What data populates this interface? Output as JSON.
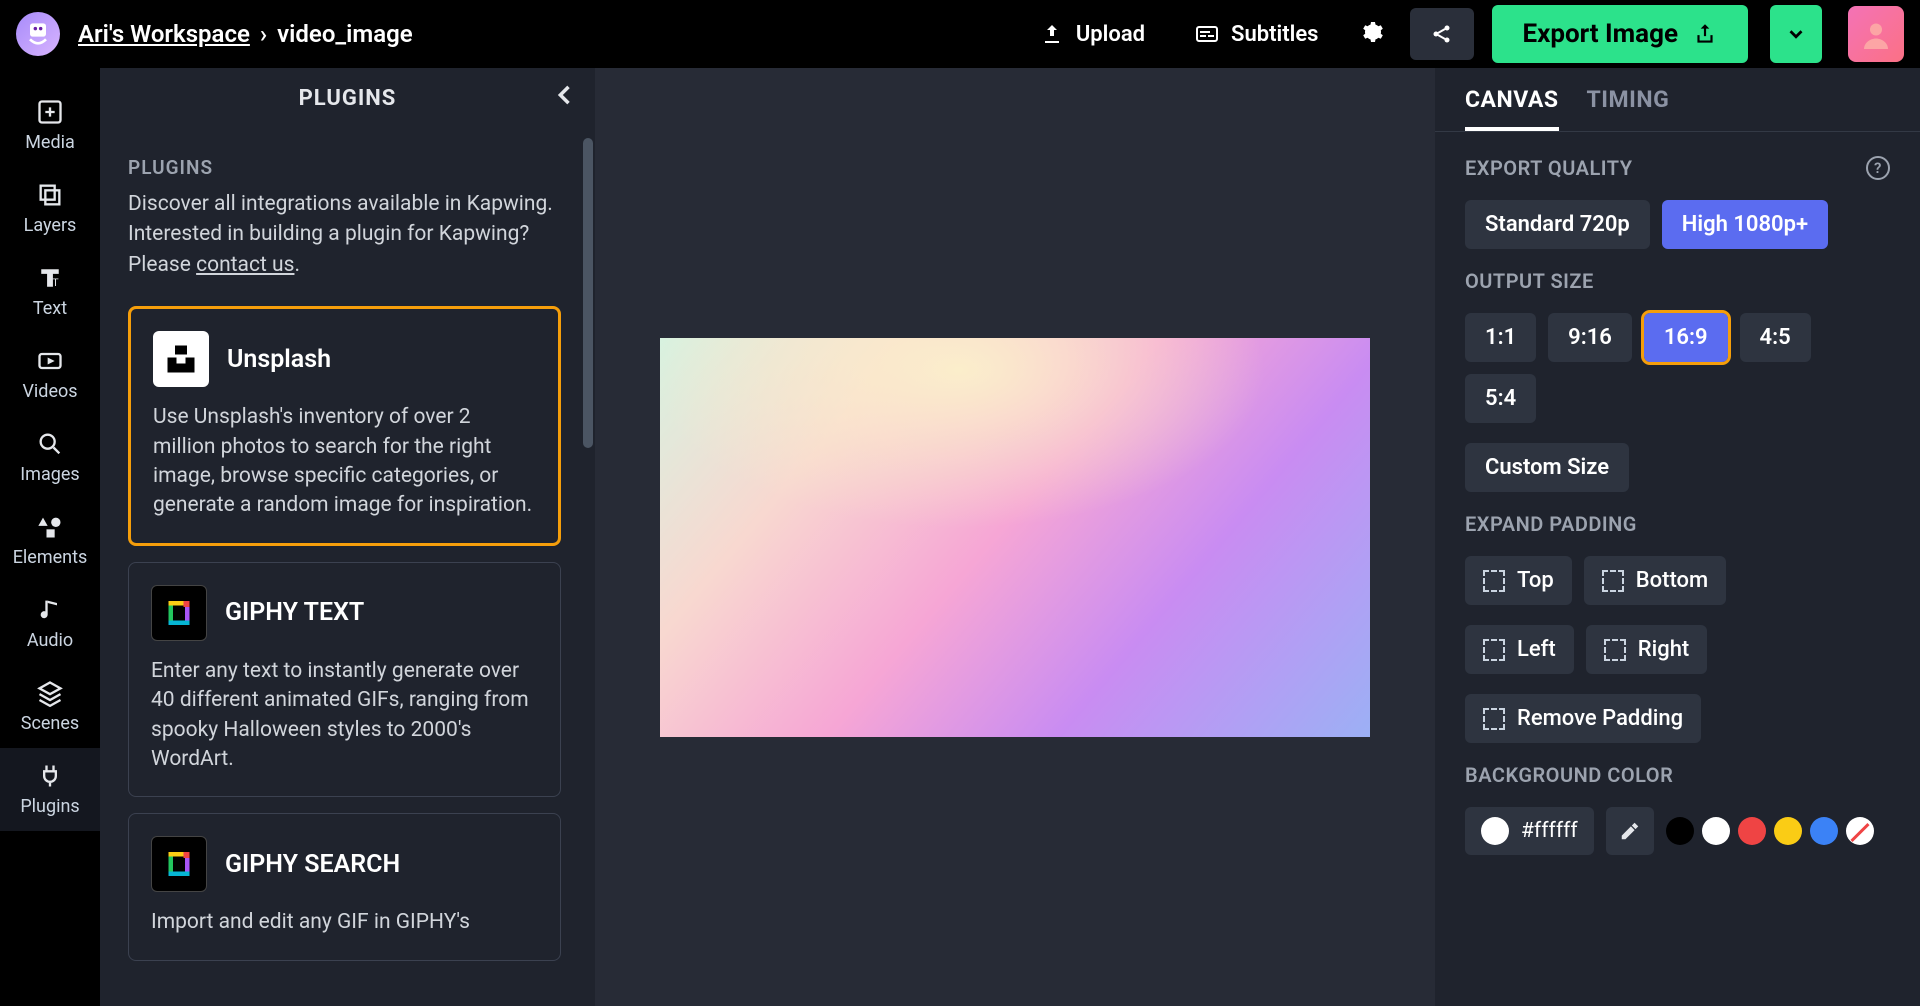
{
  "header": {
    "workspace": "Ari's Workspace",
    "project": "video_image",
    "upload": "Upload",
    "subtitles": "Subtitles",
    "export": "Export Image"
  },
  "leftnav": {
    "media": "Media",
    "layers": "Layers",
    "text": "Text",
    "videos": "Videos",
    "images": "Images",
    "elements": "Elements",
    "audio": "Audio",
    "scenes": "Scenes",
    "plugins": "Plugins"
  },
  "pluginsPanel": {
    "title": "PLUGINS",
    "sectionTitle": "PLUGINS",
    "descPrefix": "Discover all integrations available in Kapwing. Interested in building a plugin for Kapwing? Please ",
    "contact": "contact us",
    "descSuffix": ".",
    "cards": [
      {
        "name": "Unsplash",
        "desc": "Use Unsplash's inventory of over 2 million photos to search for the right image, browse specific categories, or generate a random image for inspiration."
      },
      {
        "name": "GIPHY TEXT",
        "desc": "Enter any text to instantly generate over 40 different animated GIFs, ranging from spooky Halloween styles to 2000's WordArt."
      },
      {
        "name": "GIPHY SEARCH",
        "desc": "Import and edit any GIF in GIPHY's"
      }
    ]
  },
  "rightPanel": {
    "tabs": {
      "canvas": "CANVAS",
      "timing": "TIMING"
    },
    "exportQuality": {
      "title": "EXPORT QUALITY",
      "standard": "Standard 720p",
      "high": "High 1080p+"
    },
    "outputSize": {
      "title": "OUTPUT SIZE",
      "ratios": [
        "1:1",
        "9:16",
        "16:9",
        "4:5",
        "5:4"
      ],
      "custom": "Custom Size",
      "activeRatio": "16:9"
    },
    "expandPadding": {
      "title": "EXPAND PADDING",
      "top": "Top",
      "bottom": "Bottom",
      "left": "Left",
      "right": "Right",
      "remove": "Remove Padding"
    },
    "backgroundColor": {
      "title": "BACKGROUND COLOR",
      "hex": "#ffffff",
      "swatches": [
        "#000000",
        "#ffffff",
        "#ef4444",
        "#facc15",
        "#3b82f6"
      ]
    }
  }
}
